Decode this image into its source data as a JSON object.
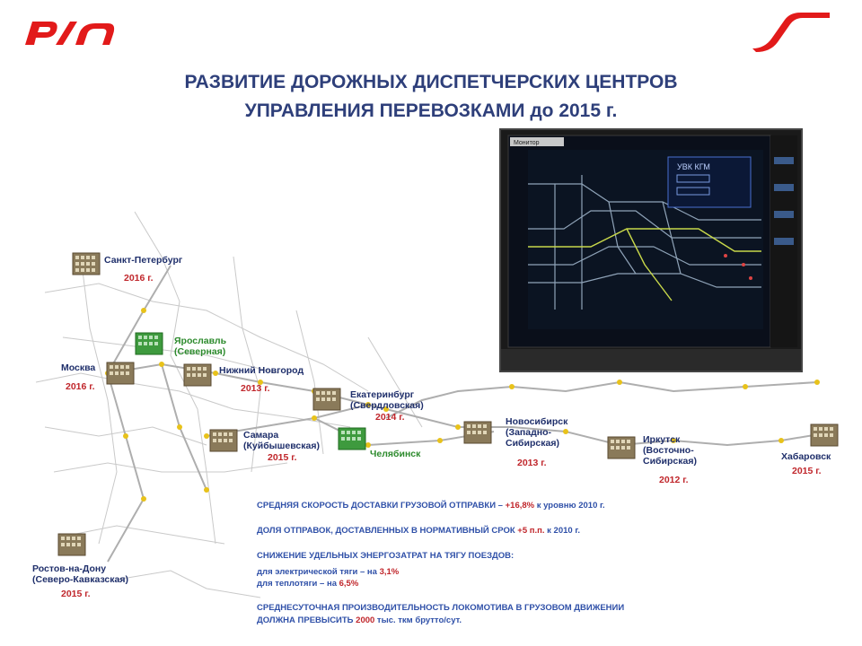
{
  "header": {
    "title_line1": "РАЗВИТИЕ ДОРОЖНЫХ  ДИСПЕТЧЕРСКИХ ЦЕНТРОВ",
    "title_line2": "УПРАВЛЕНИЯ ПЕРЕВОЗКАМИ до 2015 г."
  },
  "colors": {
    "brand_red": "#e21a1a",
    "title_blue": "#2e3f7a",
    "label_navy": "#1f2f6b",
    "year_red": "#c0262b",
    "stat_blue": "#2f50a8",
    "green": "#2c8a2c"
  },
  "centers": [
    {
      "name": "Санкт-Петербург",
      "year": "2016 г."
    },
    {
      "name": "Ярославль\n(Северная)",
      "year": ""
    },
    {
      "name": "Москва",
      "year": "2016 г."
    },
    {
      "name": "Нижний Новгород",
      "year": "2013 г."
    },
    {
      "name": "Екатеринбург\n(Свердловская)",
      "year": "2014 г."
    },
    {
      "name": "Самара\n(Куйбышевская)",
      "year": "2015 г."
    },
    {
      "name": "Челябинск",
      "year": ""
    },
    {
      "name": "Новосибирск\n(Западно-\nСибирская)",
      "year": "2013 г."
    },
    {
      "name": "Иркутск\n(Восточно-\nСибирская)",
      "year": "2012 г."
    },
    {
      "name": "Хабаровск",
      "year": "2015 г."
    },
    {
      "name": "Ростов-на-Дону\n(Северо-Кавказская)",
      "year": "2015 г."
    }
  ],
  "screen": {
    "tab": "Монитор",
    "box_title": "УВК КГМ"
  },
  "stats": {
    "s1_text": "СРЕДНЯЯ СКОРОСТЬ ДОСТАВКИ ГРУЗОВОЙ ОТПРАВКИ – ",
    "s1_value": "+16,8%",
    "s1_suffix": " к уровню 2010 г.",
    "s2_text": "ДОЛЯ ОТПРАВОК, ДОСТАВЛЕННЫХ В НОРМАТИВНЫЙ СРОК ",
    "s2_value": "+5 п.п.",
    "s2_suffix": " к 2010 г.",
    "s3_text": "СНИЖЕНИЕ УДЕЛЬНЫХ ЭНЕРГОЗАТРАТ НА ТЯГУ ПОЕЗДОВ:",
    "s3a_text": "для электрической тяги – на ",
    "s3a_value": "3,1%",
    "s3b_text": "для теплотяги – на ",
    "s3b_value": "6,5%",
    "s4_line1": "СРЕДНЕСУТОЧНАЯ ПРОИЗВОДИТЕЛЬНОСТЬ ЛОКОМОТИВА В ГРУЗОВОМ ДВИЖЕНИИ",
    "s4_text": "ДОЛЖНА ПРЕВЫСИТЬ ",
    "s4_value": "2000",
    "s4_suffix": " тыс. ткм брутто/сут."
  }
}
